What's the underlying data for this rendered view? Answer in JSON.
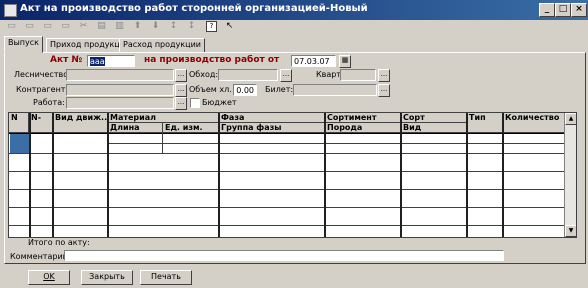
{
  "window": {
    "title": "Акт на производство работ сторонней организацией-Новый",
    "minimize_glyph": "_",
    "maximize_glyph": "□",
    "close_glyph": "×"
  },
  "toolbar": {
    "icons": [
      "new-doc-icon",
      "copy-doc-icon",
      "edit-doc-icon",
      "delete-doc-icon",
      "cut-icon",
      "paste-icon",
      "filter-icon",
      "arrow-up-icon",
      "arrow-down-icon",
      "sort-asc-icon",
      "sort-desc-icon",
      "help-icon",
      "pointer-help-icon"
    ]
  },
  "tabs": [
    "Выпуск",
    "Приход продукции",
    "Расход продукции"
  ],
  "header": {
    "act_label": "Акт №",
    "act_number": "ааа",
    "on_production_label": "на производство работ от",
    "date": "07.03.07"
  },
  "fields": {
    "forestry_label": "Лесничество:",
    "forestry_value": "",
    "round_label": "Обход:",
    "round_value": "",
    "quarter_label": "Квартал:",
    "quarter_value": "",
    "contractor_label": "Контрагент:",
    "contractor_value": "",
    "volume_label": "Объем хл.",
    "volume_value": "0.00",
    "ticket_label": "Билет:",
    "ticket_value": "",
    "work_label": "Работа:",
    "work_value": "",
    "budget_label": "Бюджет"
  },
  "grid": {
    "headers_top": [
      "N",
      "N-",
      "Вид движ...",
      "Материал",
      "Фаза",
      "Сортимент",
      "Сорт",
      "Тип",
      "Количество"
    ],
    "headers_bottom": [
      "Длина",
      "Ед. изм.",
      "Группа фазы",
      "Порода",
      "Вид"
    ]
  },
  "footer": {
    "total_label": "Итого по акту:",
    "comment_label": "Комментарий:",
    "comment_value": ""
  },
  "buttons": {
    "ok": "OK",
    "close": "Закрыть",
    "print": "Печать"
  }
}
